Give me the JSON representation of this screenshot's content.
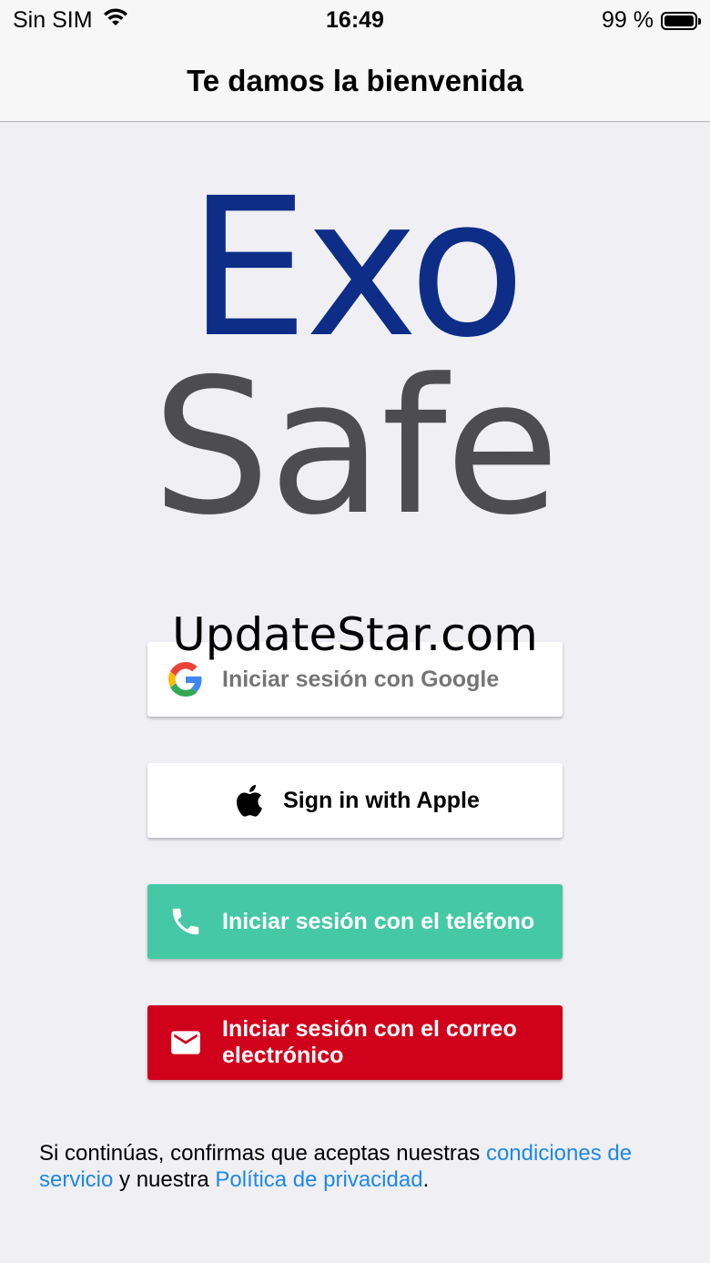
{
  "status_bar": {
    "carrier": "Sin SIM",
    "time": "16:49",
    "battery": "99 %"
  },
  "nav": {
    "title": "Te damos la bienvenida"
  },
  "logo": {
    "line1": "Exo",
    "line2": "Safe",
    "line1_color": "#0d2d87",
    "line2_color": "#4d4d50"
  },
  "watermark": "UpdateStar.com",
  "buttons": {
    "google": {
      "label": "Iniciar sesión con Google",
      "icon": "google-logo-icon"
    },
    "apple": {
      "label": "Sign in with Apple",
      "icon": "apple-logo-icon"
    },
    "phone": {
      "label": "Iniciar sesión con el teléfono",
      "icon": "phone-icon",
      "color": "#45c8a6"
    },
    "email": {
      "label": "Iniciar sesión con el correo electrónico",
      "icon": "mail-icon",
      "color": "#d0021b"
    }
  },
  "terms": {
    "prefix": "Si continúas, confirmas que aceptas nuestras ",
    "terms_link": "condiciones de servicio",
    "middle": " y nuestra ",
    "privacy_link": "Política de privacidad",
    "suffix": "."
  }
}
